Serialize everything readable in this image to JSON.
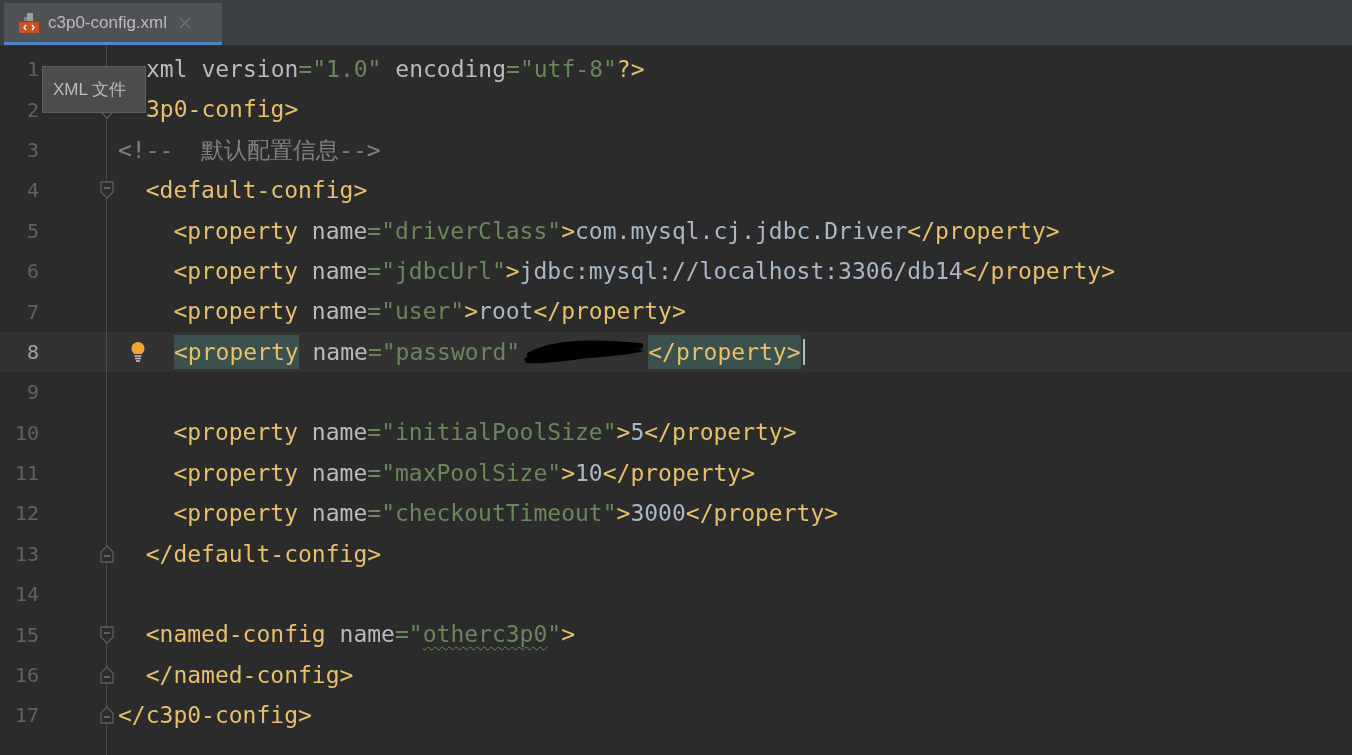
{
  "tab": {
    "title": "c3p0-config.xml",
    "selected": true
  },
  "tooltip": {
    "text": "XML 文件"
  },
  "lines": [
    {
      "number": "1",
      "current": false,
      "tokens": [
        {
          "kind": "decl",
          "text": "xml"
        },
        {
          "kind": "attr",
          "text": " version"
        },
        {
          "kind": "eq",
          "text": "="
        },
        {
          "kind": "str",
          "text": "\"1.0\""
        },
        {
          "kind": "attr",
          "text": " encoding"
        },
        {
          "kind": "eq",
          "text": "="
        },
        {
          "kind": "str",
          "text": "\"utf-8\""
        },
        {
          "kind": "tag",
          "text": "?>"
        }
      ]
    },
    {
      "number": "2",
      "current": false,
      "fold": {
        "kind": "start"
      },
      "tokens": [
        {
          "kind": "tag",
          "text": "3p0-config>"
        }
      ]
    },
    {
      "number": "3",
      "current": false,
      "tokens": [
        {
          "kind": "comment",
          "text": "<!--  默认配置信息-->"
        }
      ]
    },
    {
      "number": "4",
      "current": false,
      "fold": {
        "kind": "start"
      },
      "tokens": [
        {
          "kind": "tag",
          "text": "  <default-config>"
        }
      ]
    },
    {
      "number": "5",
      "current": false,
      "tokens": [
        {
          "kind": "tag",
          "text": "    <property"
        },
        {
          "kind": "attr",
          "text": " name"
        },
        {
          "kind": "eq",
          "text": "="
        },
        {
          "kind": "str",
          "text": "\"driverClass\""
        },
        {
          "kind": "tag",
          "text": ">"
        },
        {
          "kind": "text",
          "text": "com.mysql.cj.jdbc.Driver"
        },
        {
          "kind": "tag",
          "text": "</property>"
        }
      ]
    },
    {
      "number": "6",
      "current": false,
      "tokens": [
        {
          "kind": "tag",
          "text": "    <property"
        },
        {
          "kind": "attr",
          "text": " name"
        },
        {
          "kind": "eq",
          "text": "="
        },
        {
          "kind": "str",
          "text": "\"jdbcUrl\""
        },
        {
          "kind": "tag",
          "text": ">"
        },
        {
          "kind": "text",
          "text": "jdbc:mysql://localhost:3306/db14"
        },
        {
          "kind": "tag",
          "text": "</property>"
        }
      ]
    },
    {
      "number": "7",
      "current": false,
      "tokens": [
        {
          "kind": "tag",
          "text": "    <property"
        },
        {
          "kind": "attr",
          "text": " name"
        },
        {
          "kind": "eq",
          "text": "="
        },
        {
          "kind": "str",
          "text": "\"user\""
        },
        {
          "kind": "tag",
          "text": ">"
        },
        {
          "kind": "text",
          "text": "root"
        },
        {
          "kind": "tag",
          "text": "</property>"
        }
      ]
    },
    {
      "number": "8",
      "current": true,
      "bulb": true,
      "caret": true,
      "tokens": [
        {
          "kind": "tag",
          "text": "<property",
          "matched": true
        },
        {
          "kind": "attr",
          "text": " name"
        },
        {
          "kind": "eq",
          "text": "="
        },
        {
          "kind": "str",
          "text": "\"password\""
        },
        {
          "kind": "redaction"
        },
        {
          "kind": "tag",
          "text": "</property>",
          "matched": true
        }
      ]
    },
    {
      "number": "9",
      "current": false
    },
    {
      "number": "10",
      "current": false,
      "tokens": [
        {
          "kind": "tag",
          "text": "    <property"
        },
        {
          "kind": "attr",
          "text": " name"
        },
        {
          "kind": "eq",
          "text": "="
        },
        {
          "kind": "str",
          "text": "\"initialPoolSize\""
        },
        {
          "kind": "tag",
          "text": ">"
        },
        {
          "kind": "text",
          "text": "5"
        },
        {
          "kind": "tag",
          "text": "</property>"
        }
      ]
    },
    {
      "number": "11",
      "current": false,
      "tokens": [
        {
          "kind": "tag",
          "text": "    <property"
        },
        {
          "kind": "attr",
          "text": " name"
        },
        {
          "kind": "eq",
          "text": "="
        },
        {
          "kind": "str",
          "text": "\"maxPoolSize\""
        },
        {
          "kind": "tag",
          "text": ">"
        },
        {
          "kind": "text",
          "text": "10"
        },
        {
          "kind": "tag",
          "text": "</property>"
        }
      ]
    },
    {
      "number": "12",
      "current": false,
      "tokens": [
        {
          "kind": "tag",
          "text": "    <property"
        },
        {
          "kind": "attr",
          "text": " name"
        },
        {
          "kind": "eq",
          "text": "="
        },
        {
          "kind": "str",
          "text": "\"checkoutTimeout\""
        },
        {
          "kind": "tag",
          "text": ">"
        },
        {
          "kind": "text",
          "text": "3000"
        },
        {
          "kind": "tag",
          "text": "</property>"
        }
      ]
    },
    {
      "number": "13",
      "current": false,
      "fold": {
        "kind": "end"
      },
      "tokens": [
        {
          "kind": "tag",
          "text": "  </default-config>"
        }
      ]
    },
    {
      "number": "14",
      "current": false
    },
    {
      "number": "15",
      "current": false,
      "fold": {
        "kind": "start"
      },
      "tokens": [
        {
          "kind": "tag",
          "text": "  <named-config"
        },
        {
          "kind": "attr",
          "text": " name"
        },
        {
          "kind": "eq",
          "text": "="
        },
        {
          "kind": "str",
          "text": "\""
        },
        {
          "kind": "str",
          "text": "otherc3p0",
          "typo": true
        },
        {
          "kind": "str",
          "text": "\""
        },
        {
          "kind": "tag",
          "text": ">"
        }
      ]
    },
    {
      "number": "16",
      "current": false,
      "fold": {
        "kind": "end"
      },
      "tokens": [
        {
          "kind": "tag",
          "text": "  </named-config>"
        }
      ]
    },
    {
      "number": "17",
      "current": false,
      "fold": {
        "kind": "end"
      },
      "tokens": [
        {
          "kind": "tag",
          "text": "</c3p0-config>"
        }
      ]
    }
  ]
}
